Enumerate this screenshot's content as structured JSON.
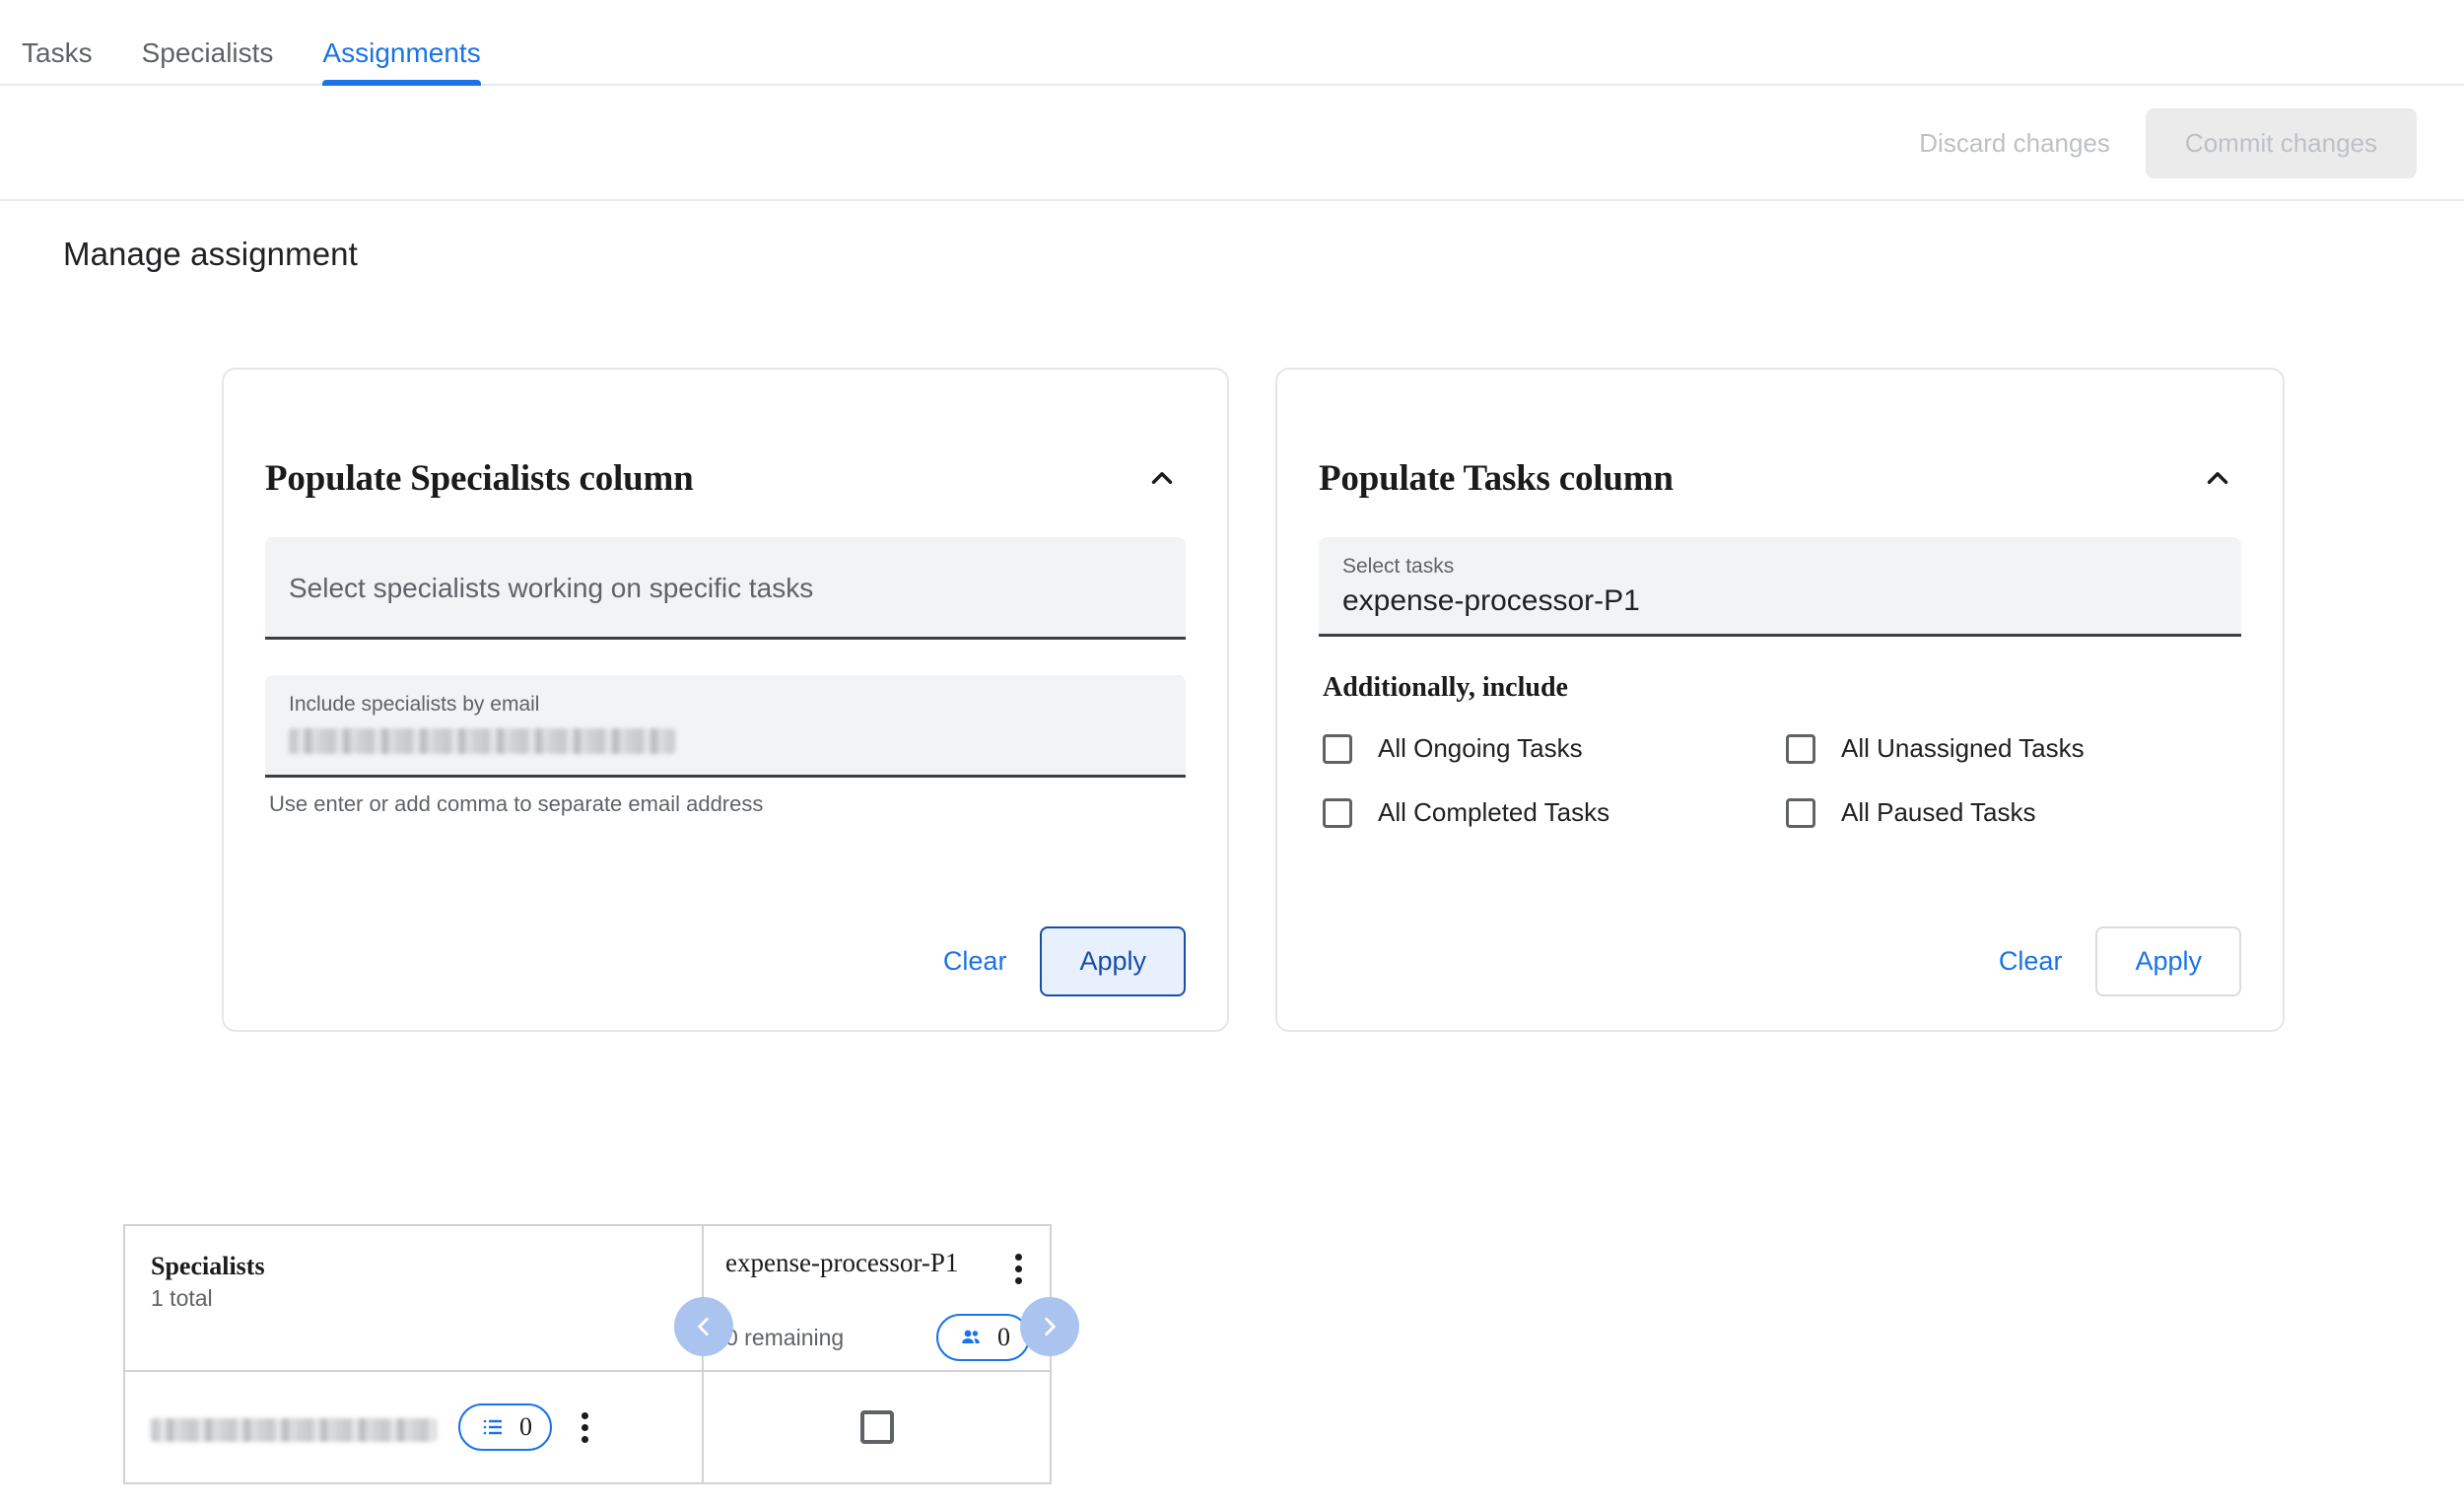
{
  "tabs": [
    {
      "label": "Tasks",
      "active": false
    },
    {
      "label": "Specialists",
      "active": false
    },
    {
      "label": "Assignments",
      "active": true
    }
  ],
  "actionbar": {
    "discard_label": "Discard changes",
    "commit_label": "Commit changes"
  },
  "page": {
    "title": "Manage assignment"
  },
  "specialists_card": {
    "title": "Populate Specialists column",
    "collapse_icon": "chevron-up-icon",
    "select_placeholder": "Select specialists working on specific tasks",
    "email_label": "Include specialists by email",
    "email_value_redacted": true,
    "helper": "Use enter or add comma to separate email address",
    "clear_label": "Clear",
    "apply_label": "Apply"
  },
  "tasks_card": {
    "title": "Populate Tasks column",
    "collapse_icon": "chevron-up-icon",
    "select_label": "Select tasks",
    "select_value": "expense-processor-P1",
    "include_heading": "Additionally, include",
    "checkboxes": [
      {
        "label": "All Ongoing Tasks",
        "checked": false
      },
      {
        "label": "All Unassigned Tasks",
        "checked": false
      },
      {
        "label": "All Completed Tasks",
        "checked": false
      },
      {
        "label": "All Paused Tasks",
        "checked": false
      }
    ],
    "clear_label": "Clear",
    "apply_label": "Apply"
  },
  "grid": {
    "header_title": "Specialists",
    "header_subtitle": "1 total",
    "task_column": {
      "name": "expense-processor-P1",
      "remaining": "0 remaining",
      "assigned_count": "0",
      "assigned_icon": "people-icon",
      "menu_icon": "kebab-menu-icon"
    },
    "nav": {
      "prev_icon": "chevron-left-icon",
      "next_icon": "chevron-right-icon"
    },
    "rows": [
      {
        "email_redacted": true,
        "count": "0",
        "count_icon": "list-icon",
        "menu_icon": "kebab-menu-icon",
        "cell_checked": false
      }
    ]
  },
  "colors": {
    "accent": "#1a73e8",
    "accent_dark": "#174ea6",
    "accent_light": "#e8f0fe",
    "nav_circle": "#aac4ef",
    "muted": "#5f6368",
    "disabled": "#bdc1c6",
    "field_bg": "#f1f3f4",
    "border": "#e4e6ea"
  }
}
